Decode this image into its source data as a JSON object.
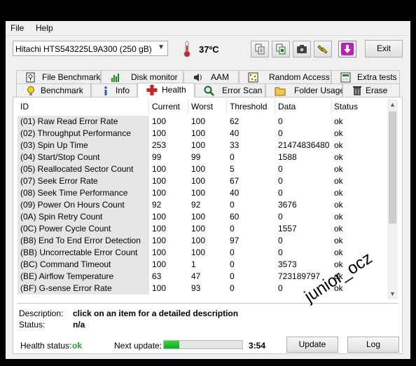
{
  "menu": {
    "file": "File",
    "help": "Help"
  },
  "toolbar": {
    "drive": "Hitachi HTS543225L9A300 (250 gB)",
    "temperature": "37ºC",
    "exit_label": "Exit",
    "buttons": [
      "copy-icon",
      "export-icon",
      "camera-icon",
      "settings-icon",
      "download-icon"
    ]
  },
  "tabs_top": [
    "File Benchmark",
    "Disk monitor",
    "AAM",
    "Random Access",
    "Extra tests"
  ],
  "tabs_bottom": [
    "Benchmark",
    "Info",
    "Health",
    "Error Scan",
    "Folder Usage",
    "Erase"
  ],
  "active_tab": "Health",
  "table": {
    "headers": [
      "ID",
      "Current",
      "Worst",
      "Threshold",
      "Data",
      "Status"
    ],
    "rows": [
      [
        "(01) Raw Read Error Rate",
        "100",
        "100",
        "62",
        "0",
        "ok"
      ],
      [
        "(02) Throughput Performance",
        "100",
        "100",
        "40",
        "0",
        "ok"
      ],
      [
        "(03) Spin Up Time",
        "253",
        "100",
        "33",
        "21474836480",
        "ok"
      ],
      [
        "(04) Start/Stop Count",
        "99",
        "99",
        "0",
        "1588",
        "ok"
      ],
      [
        "(05) Reallocated Sector Count",
        "100",
        "100",
        "5",
        "0",
        "ok"
      ],
      [
        "(07) Seek Error Rate",
        "100",
        "100",
        "67",
        "0",
        "ok"
      ],
      [
        "(08) Seek Time Performance",
        "100",
        "100",
        "40",
        "0",
        "ok"
      ],
      [
        "(09) Power On Hours Count",
        "92",
        "92",
        "0",
        "3676",
        "ok"
      ],
      [
        "(0A) Spin Retry Count",
        "100",
        "100",
        "60",
        "0",
        "ok"
      ],
      [
        "(0C) Power Cycle Count",
        "100",
        "100",
        "0",
        "1557",
        "ok"
      ],
      [
        "(B8) End To End Error Detection",
        "100",
        "100",
        "97",
        "0",
        "ok"
      ],
      [
        "(BB) Uncorrectable Error Count",
        "100",
        "100",
        "0",
        "0",
        "ok"
      ],
      [
        "(BC) Command Timeout",
        "100",
        "1",
        "0",
        "3573",
        "ok"
      ],
      [
        "(BE) Airflow Temperature",
        "63",
        "47",
        "0",
        "723189797",
        "ok"
      ],
      [
        "(BF) G-sense Error Rate",
        "100",
        "93",
        "0",
        "0",
        "ok"
      ]
    ]
  },
  "description": {
    "label": "Description:",
    "value": "click on an item for a detailed description",
    "status_label": "Status:",
    "status_value": "n/a"
  },
  "watermark": "junior_ocz",
  "footer": {
    "health_label": "Health status:",
    "health_value": "ok",
    "next_update_label": "Next update:",
    "next_update_value": "3:54",
    "progress": 0.2,
    "update_label": "Update",
    "log_label": "Log"
  },
  "colors": {
    "ok": "#1aa81a",
    "accent_red": "#d42020"
  }
}
